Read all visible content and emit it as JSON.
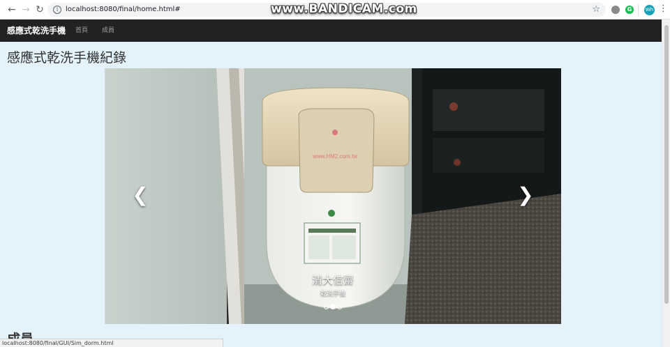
{
  "browser": {
    "back_icon": "arrow-left-icon",
    "forward_icon": "arrow-right-icon",
    "reload_icon": "reload-icon",
    "url": "localhost:8080/final/home.html#",
    "watermark": "www.BANDICAM.com",
    "avatar_initials": "Wh",
    "ext_green_label": "G",
    "status_url": "localhost:8080/final/GUI/Sim_dorm.html"
  },
  "navbar": {
    "brand": "感應式乾洗手機",
    "links": [
      {
        "label": "首頁"
      },
      {
        "label": "成員"
      }
    ]
  },
  "main": {
    "title": "感應式乾洗手機紀錄",
    "section_title": "成員"
  },
  "carousel": {
    "slide_title": "清大信齋",
    "slide_subtitle": "乾洗手機",
    "device_url": "www.HM2.com.tw",
    "slide_count": 3,
    "active_index": 1,
    "prev_icon": "chevron-left-icon",
    "next_icon": "chevron-right-icon"
  },
  "colors": {
    "navbar_bg": "#222222",
    "page_bg": "#e3f2fb",
    "brand_text": "#ffffff",
    "nav_link": "#9d9d9d"
  }
}
